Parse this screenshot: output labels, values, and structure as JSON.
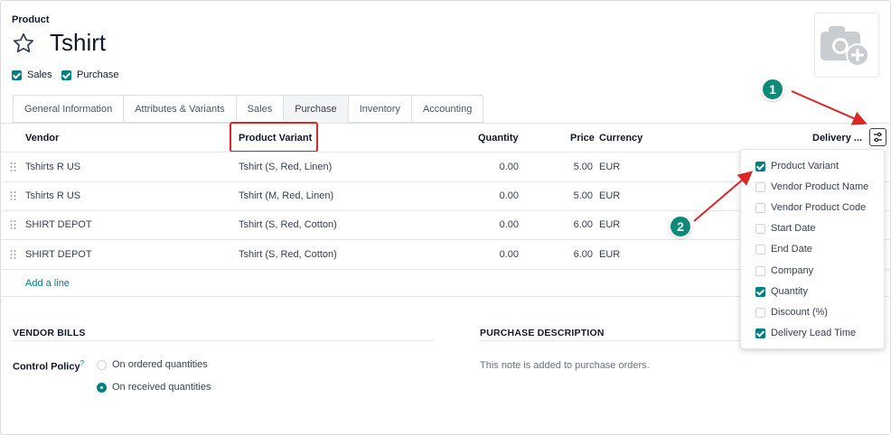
{
  "header": {
    "model_label": "Product",
    "title": "Tshirt",
    "flags": [
      {
        "label": "Sales",
        "checked": true
      },
      {
        "label": "Purchase",
        "checked": true
      }
    ]
  },
  "tabs": [
    {
      "label": "General Information",
      "active": false
    },
    {
      "label": "Attributes & Variants",
      "active": false
    },
    {
      "label": "Sales",
      "active": false
    },
    {
      "label": "Purchase",
      "active": true
    },
    {
      "label": "Inventory",
      "active": false
    },
    {
      "label": "Accounting",
      "active": false
    }
  ],
  "table": {
    "columns": {
      "vendor": "Vendor",
      "variant": "Product Variant",
      "quantity": "Quantity",
      "price": "Price",
      "currency": "Currency",
      "delivery": "Delivery ..."
    },
    "rows": [
      {
        "vendor": "Tshirts R US",
        "variant": "Tshirt (S, Red, Linen)",
        "quantity": "0.00",
        "price": "5.00",
        "currency": "EUR"
      },
      {
        "vendor": "Tshirts R US",
        "variant": "Tshirt (M, Red, Linen)",
        "quantity": "0.00",
        "price": "5.00",
        "currency": "EUR"
      },
      {
        "vendor": "SHIRT DEPOT",
        "variant": "Tshirt (S, Red, Cotton)",
        "quantity": "0.00",
        "price": "6.00",
        "currency": "EUR"
      },
      {
        "vendor": "SHIRT DEPOT",
        "variant": "Tshirt (S, Red, Cotton)",
        "quantity": "0.00",
        "price": "6.00",
        "currency": "EUR"
      }
    ],
    "add_line": "Add a line"
  },
  "optional_columns": [
    {
      "label": "Product Variant",
      "checked": true
    },
    {
      "label": "Vendor Product Name",
      "checked": false
    },
    {
      "label": "Vendor Product Code",
      "checked": false
    },
    {
      "label": "Start Date",
      "checked": false
    },
    {
      "label": "End Date",
      "checked": false
    },
    {
      "label": "Company",
      "checked": false
    },
    {
      "label": "Quantity",
      "checked": true
    },
    {
      "label": "Discount (%)",
      "checked": false
    },
    {
      "label": "Delivery Lead Time",
      "checked": true
    }
  ],
  "vendor_bills": {
    "title": "VENDOR BILLS",
    "control_policy_label": "Control Policy",
    "help_mark": "?",
    "options": [
      {
        "label": "On ordered quantities",
        "selected": false
      },
      {
        "label": "On received quantities",
        "selected": true
      }
    ]
  },
  "purchase_description": {
    "title": "PURCHASE DESCRIPTION",
    "placeholder": "This note is added to purchase orders."
  },
  "annotations": {
    "badge_1": "1",
    "badge_2": "2"
  },
  "colors": {
    "accent": "#017e84",
    "highlight": "#dc2626",
    "badge": "#0f8a78"
  }
}
